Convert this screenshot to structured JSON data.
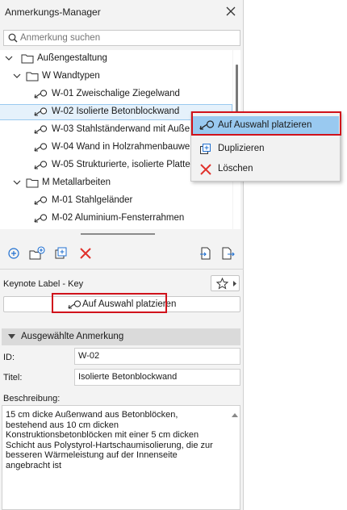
{
  "app": {
    "title": "Anmerkungs-Manager"
  },
  "search": {
    "placeholder": "Anmerkung suchen"
  },
  "tree": {
    "items": [
      {
        "label": "Außengestaltung",
        "type": "folder"
      },
      {
        "label": "W Wandtypen",
        "type": "folder"
      },
      {
        "label": "W-01 Zweischalige Ziegelwand",
        "type": "keynote"
      },
      {
        "label": "W-02 Isolierte Betonblockwand",
        "type": "keynote",
        "selected": true
      },
      {
        "label": "W-03 Stahlständerwand mit Auße",
        "type": "keynote"
      },
      {
        "label": "W-04 Wand in Holzrahmenbauwe",
        "type": "keynote"
      },
      {
        "label": "W-05 Strukturierte, isolierte Platte",
        "type": "keynote"
      },
      {
        "label": "M Metallarbeiten",
        "type": "folder"
      },
      {
        "label": "M-01 Stahlgeländer",
        "type": "keynote"
      },
      {
        "label": "M-02 Aluminium-Fensterrahmen",
        "type": "keynote"
      }
    ]
  },
  "keynote_label": {
    "label": "Keynote Label - Key",
    "place_button": "Auf Auswahl platzieren"
  },
  "selected_section": {
    "header": "Ausgewählte Anmerkung",
    "id_label": "ID:",
    "id_value": "W-02",
    "title_label": "Titel:",
    "title_value": "Isolierte Betonblockwand",
    "desc_label": "Beschreibung:",
    "desc_value": "15 cm dicke Außenwand aus Betonblöcken,\nbestehend aus 10 cm dicken\nKonstruktionsbetonblöcken mit einer 5 cm dicken\nSchicht aus Polystyrol-Hartschaumisolierung, die zur\nbesseren Wärmeleistung auf der Innenseite\nangebracht ist"
  },
  "context_menu": {
    "items": [
      {
        "label": "Auf Auswahl platzieren",
        "icon": "place-icon",
        "highlighted": true
      },
      {
        "label": "Duplizieren",
        "icon": "duplicate-icon"
      },
      {
        "label": "Löschen",
        "icon": "delete-icon"
      }
    ]
  },
  "colors": {
    "accent": "#1f6fd0",
    "highlight_red": "#d0121b",
    "menu_hover": "#99c9f0",
    "delete_red": "#e0302a"
  }
}
